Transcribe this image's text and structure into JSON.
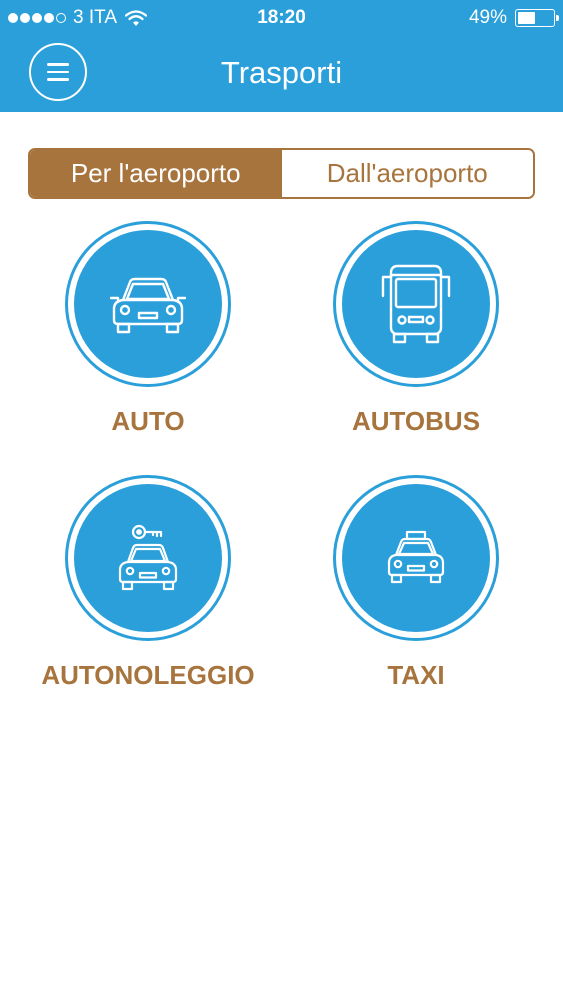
{
  "status_bar": {
    "carrier": "3 ITA",
    "time": "18:20",
    "battery": "49%",
    "battery_level": 0.49
  },
  "header": {
    "title": "Trasporti",
    "menu_icon": "hamburger-menu-icon"
  },
  "segmented_control": {
    "options": [
      "Per l'aeroporto",
      "Dall'aeroporto"
    ],
    "selected": "Per l'aeroporto"
  },
  "tiles": [
    {
      "label": "AUTO",
      "icon": "car-icon"
    },
    {
      "label": "AUTOBUS",
      "icon": "bus-icon"
    },
    {
      "label": "AUTONOLEGGIO",
      "icon": "rental-car-icon"
    },
    {
      "label": "TAXI",
      "icon": "taxi-icon"
    }
  ],
  "colors": {
    "primary_blue": "#2a9fda",
    "accent_brown": "#a8743e",
    "background": "#ffffff"
  }
}
